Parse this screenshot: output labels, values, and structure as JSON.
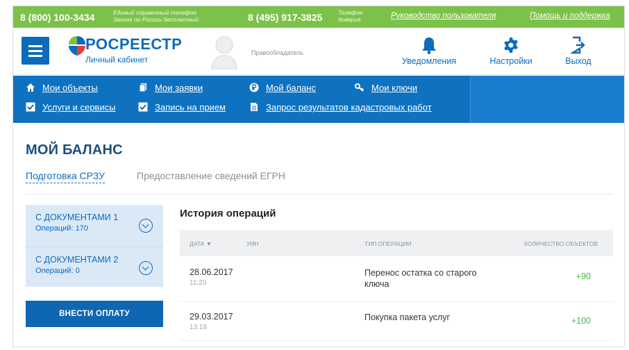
{
  "topbar": {
    "phone_free": "8 (800) 100-3434",
    "phone_free_note": "Единый справочный телефон Звонок по России бесплатный",
    "phone_trust": "8 (495) 917-3825",
    "phone_trust_note": "Телефон доверия",
    "manual_link": "Руководство пользователя",
    "help_link": "Помощь и поддержка"
  },
  "header": {
    "logo_title": "РОСРЕЕСТР",
    "logo_subtitle": "Личный кабинет",
    "owner_label": "Правообладатель",
    "notifications_label": "Уведомления",
    "settings_label": "Настройки",
    "exit_label": "Выход"
  },
  "nav": {
    "items": [
      {
        "label": "Мои объекты",
        "icon": "home-icon"
      },
      {
        "label": "Мои заявки",
        "icon": "copy-icon"
      },
      {
        "label": "Мой баланс",
        "icon": "ruble-icon"
      },
      {
        "label": "Мои ключи",
        "icon": "key-icon"
      },
      {
        "label": "Услуги и сервисы",
        "icon": "checkbox-icon"
      },
      {
        "label": "Запись на прием",
        "icon": "checkbox-icon"
      },
      {
        "label": "Запрос результатов кадастровых работ",
        "icon": "document-icon"
      }
    ]
  },
  "main": {
    "page_title": "МОЙ БАЛАНС",
    "tabs": [
      {
        "label": "Подготовка СРЗУ",
        "active": true
      },
      {
        "label": "Предоставление сведений ЕГРН",
        "active": false
      }
    ],
    "side_items": [
      {
        "title": "С ДОКУМЕНТАМИ 1",
        "ops": "Операций: 170"
      },
      {
        "title": "С ДОКУМЕНТАМИ 2",
        "ops": "Операций: 0"
      }
    ],
    "pay_button": "ВНЕСТИ ОПЛАТУ",
    "history": {
      "title": "История операций",
      "columns": {
        "date": "ДАТА ▼",
        "uin": "УИН",
        "type": "ТИП ОПЕРАЦИИ",
        "count": "КОЛИЧЕСТВО ОБЪЕКТОВ"
      },
      "rows": [
        {
          "date": "28.06.2017",
          "time": "11:20",
          "uin": "",
          "type": "Перенос остатка со старого ключа",
          "count": "+90"
        },
        {
          "date": "29.03.2017",
          "time": "13:18",
          "uin": "",
          "type": "Покупка пакета услуг",
          "count": "+100"
        }
      ]
    }
  },
  "colors": {
    "green_bar": "#7cc24a",
    "brand_blue": "#0d6bbb",
    "nav_blue": "#0f72c0",
    "side_panel": "#dbe9f7",
    "positive": "#4bb34b"
  }
}
